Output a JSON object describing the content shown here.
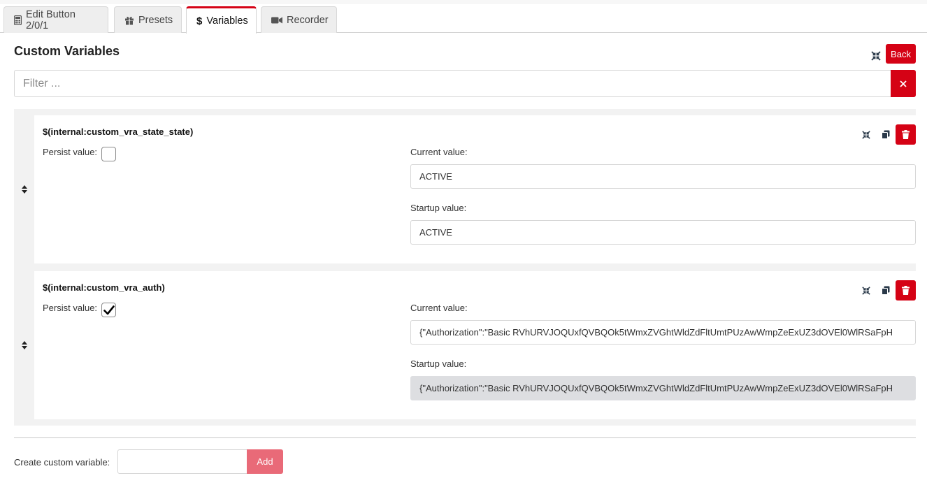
{
  "tabs": [
    {
      "label": "Edit Button 2/0/1",
      "icon": "calculator-icon",
      "active": false
    },
    {
      "label": "Presets",
      "icon": "gift-icon",
      "active": false
    },
    {
      "label": "Variables",
      "icon": "dollar-icon",
      "active": true
    },
    {
      "label": "Recorder",
      "icon": "video-icon",
      "active": false
    }
  ],
  "header": {
    "title": "Custom Variables",
    "back_label": "Back"
  },
  "filter": {
    "placeholder": "Filter ...",
    "value": ""
  },
  "variables": [
    {
      "name": "$(internal:custom_vra_state_state)",
      "persist_label": "Persist value:",
      "persist": false,
      "current_label": "Current value:",
      "current_value": "ACTIVE",
      "startup_label": "Startup value:",
      "startup_value": "ACTIVE",
      "startup_readonly": false
    },
    {
      "name": "$(internal:custom_vra_auth)",
      "persist_label": "Persist value:",
      "persist": true,
      "current_label": "Current value:",
      "current_value": "{\"Authorization\":\"Basic RVhURVJOQUxfQVBQOk5tWmxZVGhtWldZdFltUmtPUzAwWmpZeExUZ3dOVEl0WlRSaFpH",
      "startup_label": "Startup value:",
      "startup_value": "{\"Authorization\":\"Basic RVhURVJOQUxfQVBQOk5tWmxZVGhtWldZdFltUmtPUzAwWmpZeExUZ3dOVEl0WlRSaFpH",
      "startup_readonly": true
    }
  ],
  "create": {
    "label": "Create custom variable:",
    "value": "",
    "add_label": "Add"
  },
  "colors": {
    "accent": "#d50215",
    "add_disabled": "#e96a78",
    "list_bg": "#f2f2f2",
    "readonly_bg": "#dddee1"
  }
}
